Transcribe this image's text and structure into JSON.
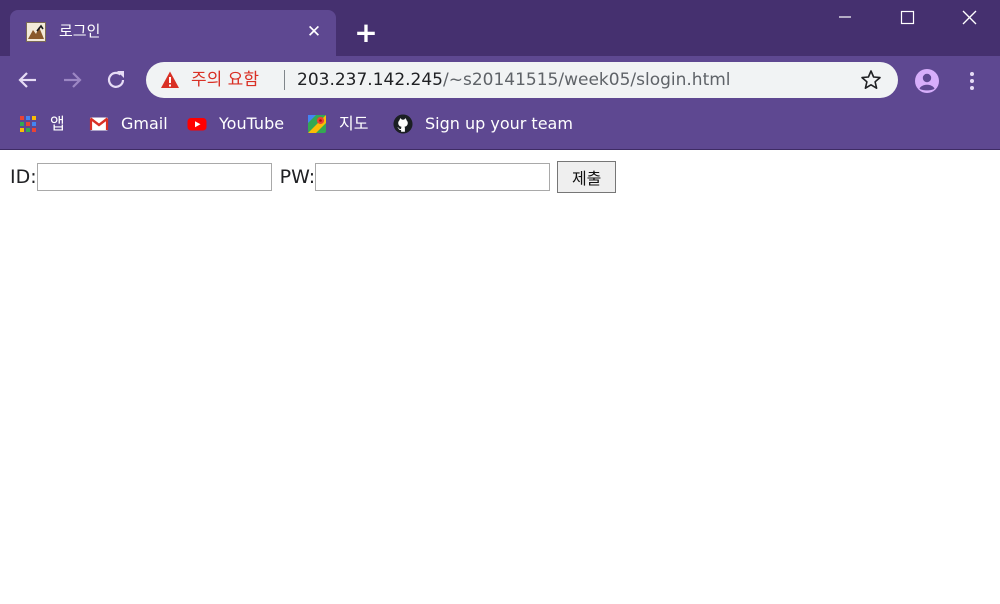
{
  "tab": {
    "title": "로그인",
    "close_glyph": "✕",
    "new_tab_glyph": "+",
    "favicon": "mountain-favicon-icon"
  },
  "window_controls": {
    "minimize": "minimize-icon",
    "maximize": "maximize-icon",
    "close": "close-icon"
  },
  "address_bar": {
    "security_warning": "주의 요함",
    "url_host": "203.237.142.245",
    "url_path": "/~s20141515/week05/slogin.html",
    "warning_color": "#d93025"
  },
  "bookmarks": [
    {
      "label": "앱",
      "icon": "apps-grid-icon"
    },
    {
      "label": "Gmail",
      "icon": "gmail-icon"
    },
    {
      "label": "YouTube",
      "icon": "youtube-icon"
    },
    {
      "label": "지도",
      "icon": "maps-icon"
    },
    {
      "label": "Sign up your team",
      "icon": "github-icon"
    }
  ],
  "login_form": {
    "id_label": "ID:",
    "id_value": "",
    "pw_label": "PW:",
    "pw_value": "",
    "submit_label": "제출"
  },
  "colors": {
    "frame_dark": "#45306f",
    "frame": "#5e4891",
    "omnibox": "#f1f3f4",
    "profile": "#d7aefb"
  }
}
